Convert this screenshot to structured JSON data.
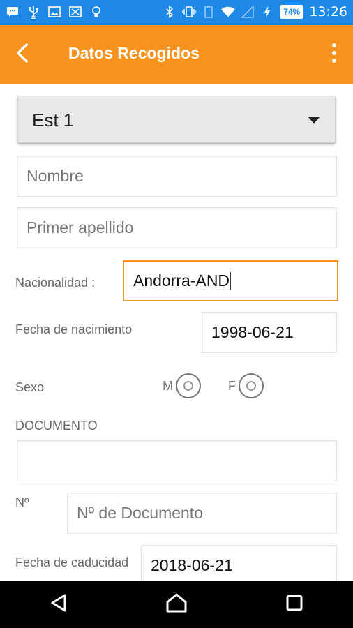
{
  "status_bar": {
    "time": "13:26",
    "battery": "74%",
    "icons": [
      "message-icon",
      "usb-icon",
      "image-icon",
      "cast-off-icon",
      "lightbulb-icon",
      "bluetooth-icon",
      "vibrate-icon",
      "battery-outline-icon",
      "wifi-icon",
      "signal-icon",
      "charging-icon"
    ]
  },
  "app_bar": {
    "title": "Datos Recogidos",
    "accent_color": "#f7931e"
  },
  "form": {
    "spinner_value": "Est 1",
    "nombre_placeholder": "Nombre",
    "apellido_placeholder": "Primer apellido",
    "nacionalidad_label": "Nacionalidad :",
    "nacionalidad_value": "Andorra-AND",
    "fecha_nacimiento_label": "Fecha de nacimiento",
    "fecha_nacimiento_value": "1998-06-21",
    "sexo_label": "Sexo",
    "sexo_options": [
      "M",
      "F"
    ],
    "documento_label": "DOCUMENTO",
    "documento_value": "",
    "numero_label": "Nº",
    "numero_placeholder": "Nº de Documento",
    "fecha_caducidad_label": "Fecha de caducidad",
    "fecha_caducidad_value": "2018-06-21"
  }
}
